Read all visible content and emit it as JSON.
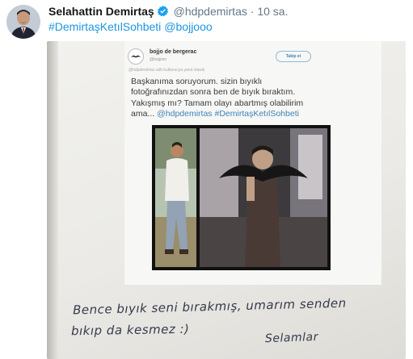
{
  "tweet": {
    "author_name": "Selahattin Demirtaş",
    "author_handle": "@hdpdemirtas",
    "separator": "·",
    "time": "10 sa.",
    "hashtag": "#DemirtaşKetılSohbeti",
    "mention": "@bojjooo"
  },
  "image": {
    "quoted_tweet": {
      "name": "bojjo de bergerac",
      "handle": "@bojjooo",
      "follow_label": "Takip et",
      "reply_context": "@hdpdemirtas adlı kullanıcıya yanıt olarak",
      "body_line1": "Başkanıma soruyorum. sizin bıyıklı",
      "body_line2": "fotoğrafınızdan sonra ben de bıyık bıraktım.",
      "body_line3": "Yakışmış mı?  Tamam olayı abartmış olabilirim",
      "body_line4_prefix": "ama...",
      "body_mention": "@hdpdemirtas",
      "body_hashtag": "#DemirtaşKetılSohbeti"
    },
    "handwritten_line1": "Bence bıyık seni bırakmış, umarım senden",
    "handwritten_line2": "bıkıp da kesmez :)",
    "handwritten_signature": "Selamlar"
  },
  "icons": {
    "verified": "verified-badge-icon",
    "avatar": "avatar-photo",
    "quoted_avatar": "mustache-avatar-icon"
  },
  "colors": {
    "link": "#1b95e0",
    "name": "#14171a",
    "meta": "#657786",
    "verified": "#1da1f2",
    "ink": "#353a4c"
  }
}
